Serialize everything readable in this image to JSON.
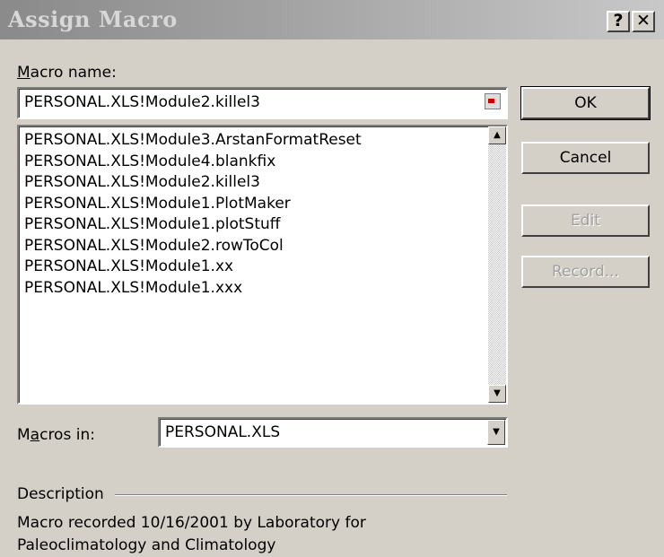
{
  "window": {
    "title": "Assign Macro",
    "help_label": "?",
    "close_label": "✕"
  },
  "macro_name": {
    "label_accel": "M",
    "label_rest": "acro name:",
    "value": "PERSONAL.XLS!Module2.killel3",
    "refedit_icon": "collapse-dialog-icon"
  },
  "macro_list": [
    "PERSONAL.XLS!Module3.ArstanFormatReset",
    "PERSONAL.XLS!Module4.blankfix",
    "PERSONAL.XLS!Module2.killel3",
    "PERSONAL.XLS!Module1.PlotMaker",
    "PERSONAL.XLS!Module1.plotStuff",
    "PERSONAL.XLS!Module2.rowToCol",
    "PERSONAL.XLS!Module1.xx",
    "PERSONAL.XLS!Module1.xxx"
  ],
  "buttons": {
    "ok": "OK",
    "cancel": "Cancel",
    "edit": "Edit",
    "record": "Record..."
  },
  "macros_in": {
    "label_pre": "M",
    "label_accel": "a",
    "label_rest": "cros in:",
    "value": "PERSONAL.XLS"
  },
  "description": {
    "label": "Description",
    "line1": "Macro recorded 10/16/2001 by Laboratory for",
    "line2": "Paleoclimatology and Climatology"
  }
}
